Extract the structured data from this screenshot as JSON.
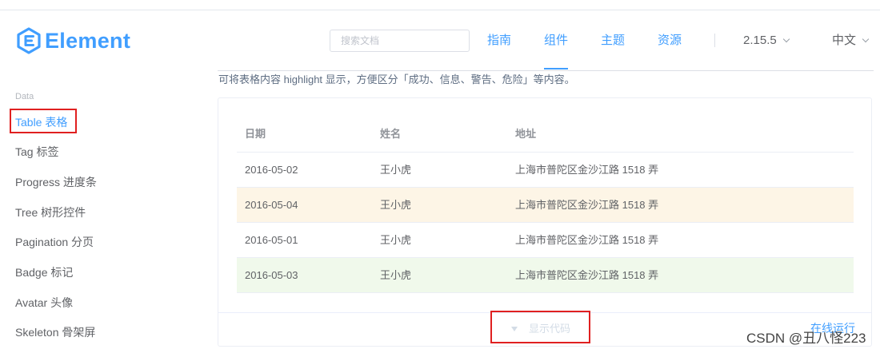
{
  "header": {
    "logo_text": "Element",
    "search": {
      "placeholder": "搜索文档"
    },
    "nav": [
      "指南",
      "组件",
      "主题",
      "资源"
    ],
    "active_nav": "组件",
    "version": "2.15.5",
    "language": "中文",
    "accent_color": "#409EFF"
  },
  "sidebar": {
    "group_title": "Data",
    "items": [
      {
        "label": "Table 表格",
        "active": true
      },
      {
        "label": "Tag 标签"
      },
      {
        "label": "Progress 进度条"
      },
      {
        "label": "Tree 树形控件"
      },
      {
        "label": "Pagination 分页"
      },
      {
        "label": "Badge 标记"
      },
      {
        "label": "Avatar 头像"
      },
      {
        "label": "Skeleton 骨架屏"
      }
    ]
  },
  "main": {
    "description": "可将表格内容 highlight 显示，方便区分「成功、信息、警告、危险」等内容。",
    "table": {
      "columns": [
        "日期",
        "姓名",
        "地址"
      ],
      "rows": [
        {
          "date": "2016-05-02",
          "name": "王小虎",
          "address": "上海市普陀区金沙江路 1518 弄",
          "row_state": ""
        },
        {
          "date": "2016-05-04",
          "name": "王小虎",
          "address": "上海市普陀区金沙江路 1518 弄",
          "row_state": "warning"
        },
        {
          "date": "2016-05-01",
          "name": "王小虎",
          "address": "上海市普陀区金沙江路 1518 弄",
          "row_state": ""
        },
        {
          "date": "2016-05-03",
          "name": "王小虎",
          "address": "上海市普陀区金沙江路 1518 弄",
          "row_state": "success"
        }
      ],
      "warning_row_color": "#fdf5e6",
      "success_row_color": "#f0f9eb"
    },
    "show_code_label": "显示代码",
    "run_online_label": "在线运行"
  },
  "watermark": "CSDN @丑八怪223",
  "annotation_color": "#e02020"
}
